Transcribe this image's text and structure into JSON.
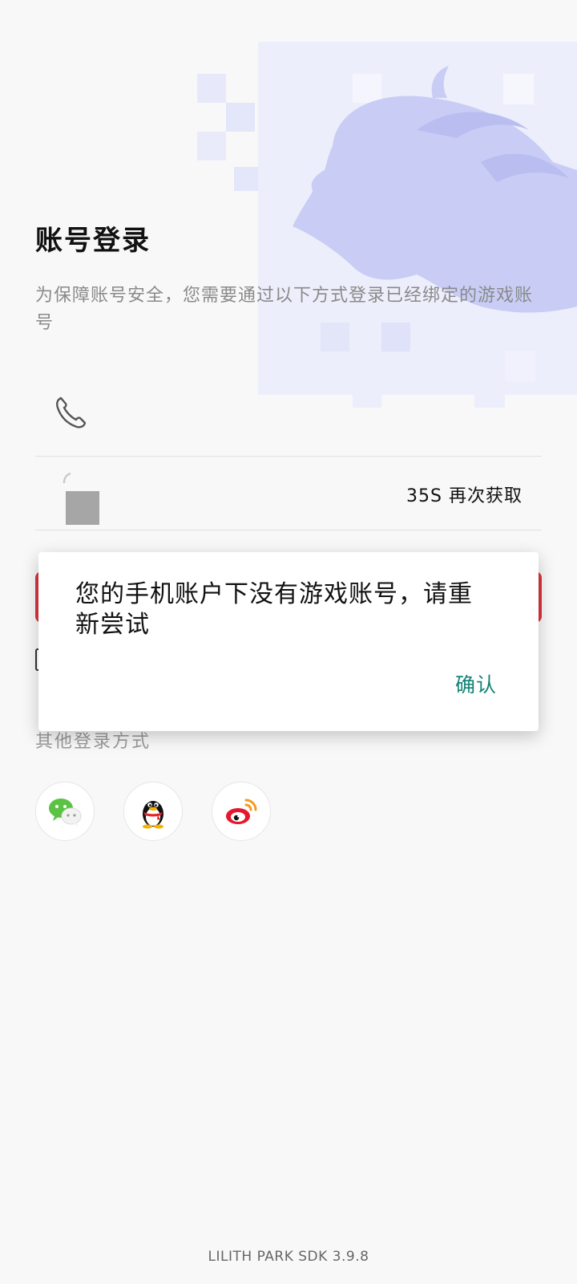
{
  "login": {
    "title": "账号登录",
    "subtitle": "为保障账号安全，您需要通过以下方式登录已经绑定的游戏账号"
  },
  "phone_field": {
    "icon": "phone-icon"
  },
  "code_field": {
    "icon": "lock-icon",
    "resend_label": "35S 再次获取"
  },
  "other": {
    "label": "其他登录方式",
    "methods": [
      {
        "icon": "wechat-icon"
      },
      {
        "icon": "qq-icon"
      },
      {
        "icon": "weibo-icon"
      }
    ]
  },
  "footer": {
    "version": "LILITH PARK SDK 3.9.8"
  },
  "dialog": {
    "message": "您的手机账户下没有游戏账号，请重新尝试",
    "confirm_label": "确认"
  },
  "colors": {
    "accent_red": "#d9363e",
    "dialog_confirm": "#128274",
    "hero_purple": "#c9cdf5"
  }
}
